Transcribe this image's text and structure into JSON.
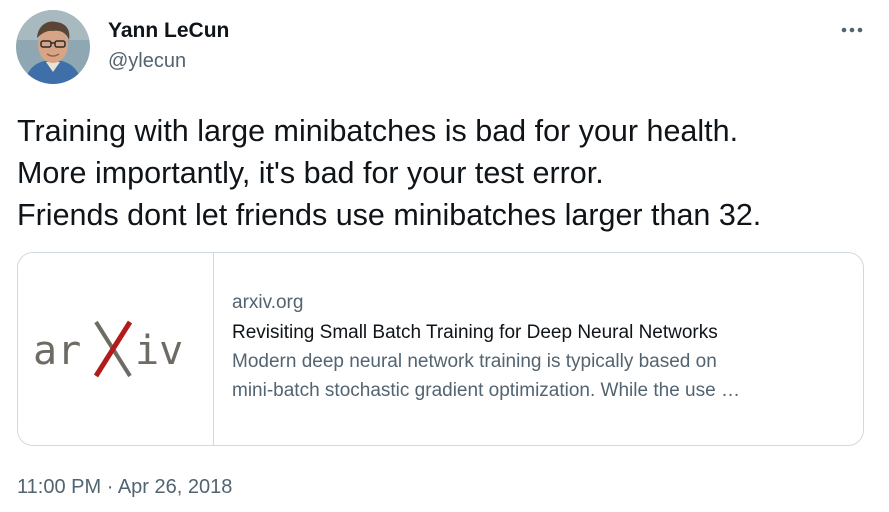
{
  "author": {
    "name": "Yann LeCun",
    "handle": "@ylecun"
  },
  "tweet": {
    "lines": [
      "Training with large minibatches is bad for your health.",
      "More importantly, it's bad for your test error.",
      "Friends dont let friends use minibatches larger than 32."
    ]
  },
  "card": {
    "logo_text": "arXiv",
    "domain": "arxiv.org",
    "title": "Revisiting Small Batch Training for Deep Neural Networks",
    "description_lines": [
      "Modern deep neural network training is typically based on",
      "mini-batch stochastic gradient optimization. While the use …"
    ]
  },
  "meta": {
    "time": "11:00 PM",
    "separator": "·",
    "date": "Apr 26, 2018"
  },
  "icons": {
    "more": "more-horizontal-icon"
  },
  "colors": {
    "text_primary": "#0f1419",
    "text_secondary": "#536471",
    "border": "#cfd9de",
    "arxiv_gray": "#6e6a64",
    "arxiv_red": "#b31b1b"
  }
}
